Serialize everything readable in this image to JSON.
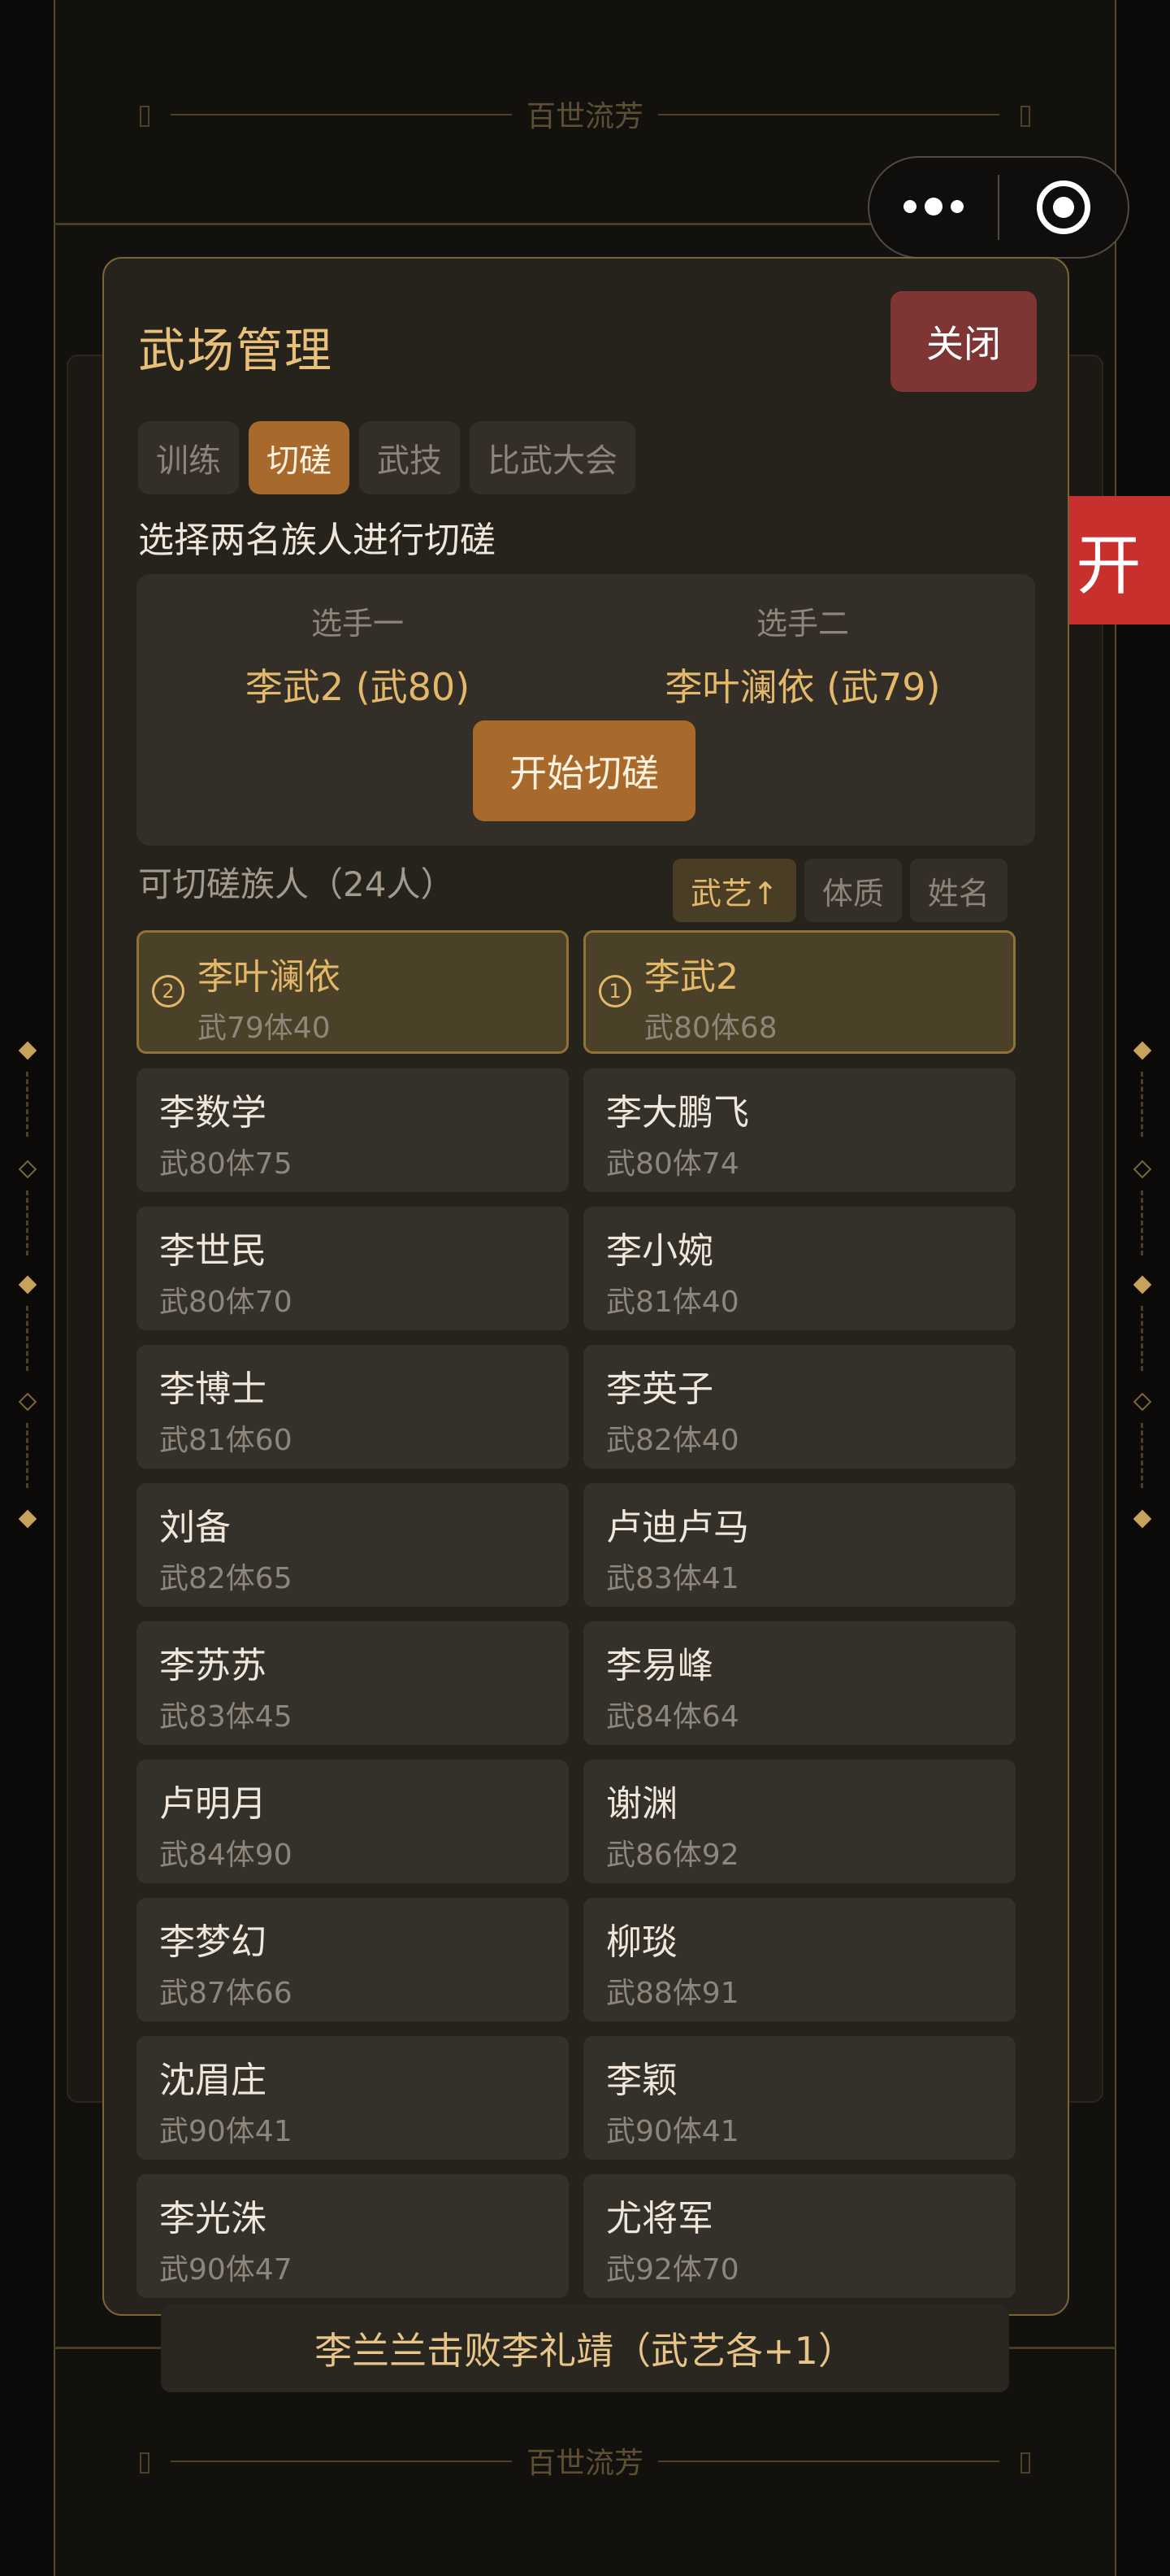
{
  "page": {
    "title": "百世流芳",
    "footer_title": "百世流芳"
  },
  "float_button": {
    "label": "开"
  },
  "modal": {
    "title": "武场管理",
    "close_label": "关闭",
    "tabs": [
      {
        "label": "训练",
        "active": false
      },
      {
        "label": "切磋",
        "active": true
      },
      {
        "label": "武技",
        "active": false
      },
      {
        "label": "比武大会",
        "active": false
      }
    ],
    "instruction": "选择两名族人进行切磋",
    "player1": {
      "label": "选手一",
      "name": "李武2 (武80)"
    },
    "player2": {
      "label": "选手二",
      "name": "李叶澜依 (武79)"
    },
    "start_label": "开始切磋",
    "list_header": "可切磋族人（24人）",
    "sorts": [
      {
        "label": "武艺↑",
        "active": true
      },
      {
        "label": "体质",
        "active": false
      },
      {
        "label": "姓名",
        "active": false
      }
    ],
    "members": [
      {
        "name": "李叶澜依",
        "stat": "武79体40",
        "selected": true,
        "order": "2"
      },
      {
        "name": "李武2",
        "stat": "武80体68",
        "selected": true,
        "order": "1"
      },
      {
        "name": "李数学",
        "stat": "武80体75"
      },
      {
        "name": "李大鹏飞",
        "stat": "武80体74"
      },
      {
        "name": "李世民",
        "stat": "武80体70"
      },
      {
        "name": "李小婉",
        "stat": "武81体40"
      },
      {
        "name": "李博士",
        "stat": "武81体60"
      },
      {
        "name": "李英子",
        "stat": "武82体40"
      },
      {
        "name": "刘备",
        "stat": "武82体65"
      },
      {
        "name": "卢迪卢马",
        "stat": "武83体41"
      },
      {
        "name": "李苏苏",
        "stat": "武83体45"
      },
      {
        "name": "李易峰",
        "stat": "武84体64"
      },
      {
        "name": "卢明月",
        "stat": "武84体90"
      },
      {
        "name": "谢渊",
        "stat": "武86体92"
      },
      {
        "name": "李梦幻",
        "stat": "武87体66"
      },
      {
        "name": "柳琰",
        "stat": "武88体91"
      },
      {
        "name": "沈眉庄",
        "stat": "武90体41"
      },
      {
        "name": "李颖",
        "stat": "武90体41"
      },
      {
        "name": "李光洙",
        "stat": "武90体47"
      },
      {
        "name": "尤将军",
        "stat": "武92体70"
      }
    ]
  },
  "toast": "李兰兰击败李礼靖（武艺各+1）",
  "colors": {
    "accent": "#a8692c",
    "gold": "#e3b869",
    "danger": "#c8302d",
    "close": "#7e3533"
  }
}
